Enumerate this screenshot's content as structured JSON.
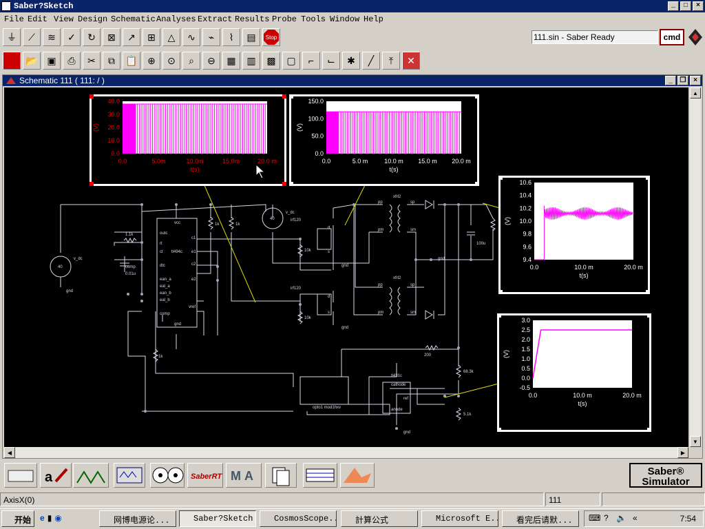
{
  "window": {
    "title": "Saber?Sketch"
  },
  "menu": [
    "File",
    "Edit",
    "View",
    "Design",
    "Schematic",
    "Analyses",
    "Extract",
    "Results",
    "Probe",
    "Tools",
    "Window",
    "Help"
  ],
  "status_text": "111.sin - Saber Ready",
  "cmd_label": "cmd",
  "stop_label": "Stop",
  "schematic": {
    "title": "Schematic 111 ( 111: / )"
  },
  "components": {
    "ic_label": "tl494c",
    "vcc": "vcc",
    "outc": "outc",
    "rt": "rt",
    "ct": "ct",
    "dtc": "dtc",
    "ean_a": "ean_a",
    "eal_a": "eal_a",
    "ean_b": "ean_b",
    "eal_b": "eal_b",
    "comp": "comp",
    "c1": "c1",
    "e1": "e1",
    "c2": "c2",
    "e2": "e2",
    "vref": "vref",
    "gnd": "gnd",
    "vdc1": "v_dc",
    "vdc1_val": "40",
    "vdc2": "v_dc",
    "vdc2_val": "40",
    "r_rt": "1.1k",
    "c_ct": "0.01u",
    "c_ct2": "comp",
    "r_1k": "1k",
    "r_top1": "1k",
    "r_top2": "1k",
    "mos1": "irf120",
    "mos2": "irf120",
    "r10k1": "10k",
    "r10k2": "10k",
    "xfr1": "xfrl2",
    "xfr2": "xfrl2",
    "pp": "pp",
    "pm": "pm",
    "sp": "sp",
    "sm": "sm",
    "cap_out": "100u",
    "r_200": "200",
    "r_68k": "68.3k",
    "r_51k": "5.1k",
    "opto": "opto1 mod1hxv",
    "tl431": "tl431c",
    "cathode": "cathode",
    "anode": "anode",
    "ref": "ref",
    "d": "d",
    "s": "s"
  },
  "plots": [
    {
      "id": "p1",
      "ylabel": "(V)",
      "xlabel": "t(s)",
      "yticks": [
        "40.0",
        "30.0",
        "20.0",
        "10.0",
        "0.0"
      ],
      "xticks": [
        "0.0",
        "5.0m",
        "10.0m",
        "15.0m",
        "20.0 m"
      ],
      "color": "#ff00ff"
    },
    {
      "id": "p2",
      "ylabel": "(V)",
      "xlabel": "t(s)",
      "yticks": [
        "150.0",
        "100.0",
        "50.0",
        "0.0"
      ],
      "xticks": [
        "0.0",
        "5.0 m",
        "10.0 m",
        "15.0 m",
        "20.0 m"
      ],
      "color": "#ff00ff"
    },
    {
      "id": "p3",
      "ylabel": "(V)",
      "xlabel": "t(s)",
      "yticks": [
        "10.6",
        "10.4",
        "10.2",
        "10.0",
        "9.8",
        "9.6",
        "9.4"
      ],
      "xticks": [
        "0.0",
        "10.0 m",
        "20.0 m"
      ],
      "color": "#ff00ff"
    },
    {
      "id": "p4",
      "ylabel": "(V)",
      "xlabel": "t(s)",
      "yticks": [
        "3.0",
        "2.5",
        "2.0",
        "1.5",
        "1.0",
        "0.5",
        "0.0",
        "-0.5"
      ],
      "xticks": [
        "0.0",
        "10.0 m",
        "20.0 m"
      ],
      "color": "#ff00ff"
    }
  ],
  "bottom": {
    "saber_line1": "Saber®",
    "saber_line2": "Simulator",
    "saber_rt": "SaberRT"
  },
  "statusbar": {
    "left": "AxisX(0)",
    "mid": "111"
  },
  "taskbar": {
    "start": "开始",
    "tasks": [
      "网博电源论...",
      "Saber?Sketch",
      "CosmosScope...",
      "計算公式",
      "Microsoft E...",
      "看完后请默..."
    ],
    "clock": "7:54"
  }
}
